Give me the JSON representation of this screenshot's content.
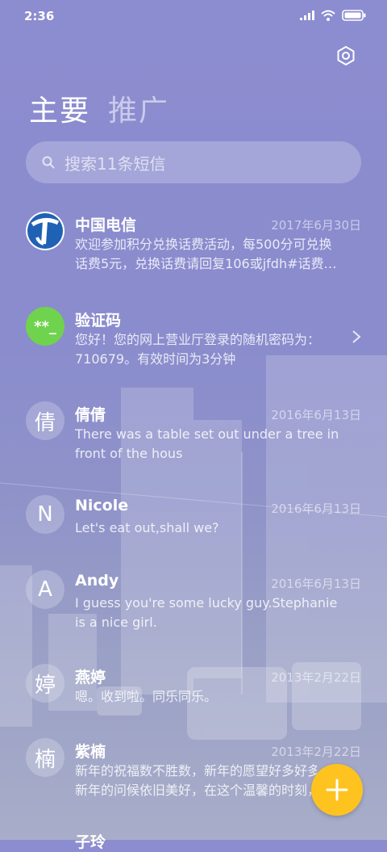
{
  "status_bar": {
    "time": "2:36"
  },
  "tabs": {
    "primary": "主要",
    "promotions": "推广"
  },
  "search": {
    "placeholder": "搜索11条短信"
  },
  "messages": [
    {
      "avatar_text": "",
      "avatar_icon": "china-telecom-logo",
      "sender": "中国电信",
      "date": "2017年6月30日",
      "preview_1": "欢迎参加积分兑换话费活动，每500分可兑换",
      "preview_2": "话费5元，兑换话费请回复106或jfdh#话费…"
    },
    {
      "avatar_text": "**_",
      "avatar_color": "#6fd34d",
      "sender": "验证码",
      "date": "",
      "preview_1": "您好！您的网上营业厅登录的随机密码为：",
      "preview_2": "710679。有效时间为3分钟"
    },
    {
      "avatar_text": "倩",
      "sender": "倩倩",
      "date": "2016年6月13日",
      "preview_1": "There was a table set out under a tree in",
      "preview_2": "front of the hous"
    },
    {
      "avatar_text": "N",
      "sender": "Nicole",
      "date": "2016年6月13日",
      "preview_1": "Let's eat out,shall we?",
      "preview_2": ""
    },
    {
      "avatar_text": "A",
      "sender": "Andy",
      "date": "2016年6月13日",
      "preview_1": "I guess you're some lucky guy.Stephanie",
      "preview_2": "is a nice girl."
    },
    {
      "avatar_text": "婷",
      "sender": "燕婷",
      "date": "2013年2月22日",
      "preview_1": "嗯。收到啦。同乐同乐。",
      "preview_2": ""
    },
    {
      "avatar_text": "楠",
      "sender": "紫楠",
      "date": "2013年2月22日",
      "preview_1": "新年的祝福数不胜数，新年的愿望好多好多，",
      "preview_2": "新年的问候依旧美好，在这个温馨的时刻，"
    },
    {
      "avatar_text": "",
      "sender": "子玲",
      "date": "",
      "preview_1": "",
      "preview_2": ""
    }
  ],
  "fab": {
    "icon": "plus-icon"
  },
  "colors": {
    "fab": "#ffc31f",
    "verify_avatar": "#6fd34d",
    "telecom_blue": "#1f62b5"
  }
}
